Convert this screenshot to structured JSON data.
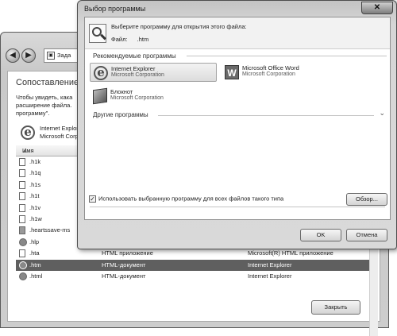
{
  "background_window": {
    "address_text": "Зада",
    "title": "Сопоставление",
    "description": "Чтобы увидеть, кака расширение файла. программу\".",
    "current_program": {
      "name": "Internet Explor",
      "company": "Microsoft Corpor"
    },
    "column_name": "Имя",
    "rows": [
      {
        "ext": ".h1k",
        "type": "",
        "default": "",
        "icon": "file-icon"
      },
      {
        "ext": ".h1q",
        "type": "",
        "default": "",
        "icon": "file-icon"
      },
      {
        "ext": ".h1s",
        "type": "",
        "default": "",
        "icon": "file-icon"
      },
      {
        "ext": ".h1t",
        "type": "",
        "default": "",
        "icon": "file-icon"
      },
      {
        "ext": ".h1v",
        "type": "",
        "default": "",
        "icon": "file-icon"
      },
      {
        "ext": ".h1w",
        "type": "",
        "default": "",
        "icon": "file-icon"
      },
      {
        "ext": ".heartssave-ms",
        "type": "",
        "default": "",
        "icon": "gear-file-icon"
      },
      {
        "ext": ".hlp",
        "type": "",
        "default": "",
        "icon": "help-file-icon"
      },
      {
        "ext": ".hta",
        "type": "HTML приложение",
        "default": "Microsoft(R) HTML приложение",
        "icon": "file-icon"
      },
      {
        "ext": ".htm",
        "type": "HTML-документ",
        "default": "Internet Explorer",
        "icon": "ie-file-icon",
        "selected": true
      },
      {
        "ext": ".html",
        "type": "HTML-документ",
        "default": "Internet Explorer",
        "icon": "ie-file-icon"
      }
    ],
    "close_label": "Закрыть"
  },
  "dialog": {
    "title": "Выбор программы",
    "close_glyph": "✕",
    "prompt": "Выберите программу для открытия этого файла:",
    "file_label": "Файл:",
    "file_value": ".htm",
    "recommended_header": "Рекомендуемые программы",
    "programs": [
      {
        "name": "Internet Explorer",
        "company": "Microsoft Corporation",
        "icon": "internet-explorer-icon",
        "selected": true
      },
      {
        "name": "Microsoft Office Word",
        "company": "Microsoft Corporation",
        "icon": "word-icon"
      },
      {
        "name": "Блокнот",
        "company": "Microsoft Corporation",
        "icon": "notepad-icon"
      }
    ],
    "other_header": "Другие программы",
    "always_use_label": "Использовать выбранную программу для всех файлов такого типа",
    "always_use_checked": true,
    "browse_label": "Обзор...",
    "ok_label": "OK",
    "cancel_label": "Отмена"
  }
}
